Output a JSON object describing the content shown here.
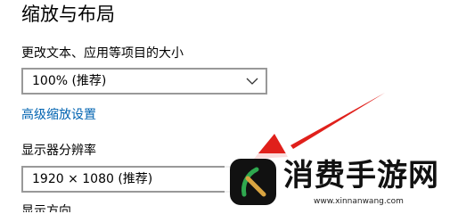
{
  "section": {
    "title": "缩放与布局"
  },
  "scale": {
    "label": "更改文本、应用等项目的大小",
    "value": "100% (推荐)",
    "advanced_link": "高级缩放设置"
  },
  "resolution": {
    "label": "显示器分辨率",
    "value": "1920 × 1080 (推荐)"
  },
  "orientation": {
    "label": "显示方向"
  },
  "watermark": {
    "brand": "消费手游网",
    "url": "www.xinnanwang.com"
  },
  "colors": {
    "link": "#0063b1",
    "dropdown_border": "#999999",
    "arrow": "#e0201b",
    "logo_bg": "#111111"
  },
  "icons": {
    "dropdown": "chevron-down-icon",
    "watermark_logo": "leaf-logo-icon"
  }
}
